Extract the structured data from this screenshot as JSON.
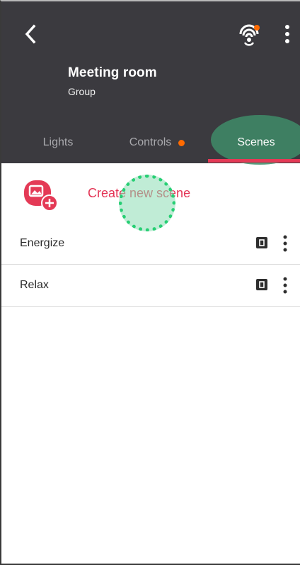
{
  "header": {
    "title": "Meeting room",
    "subtitle": "Group",
    "back_icon": "chevron-left-icon",
    "network_icon": "bridge-sync-icon",
    "more_icon": "more-vertical-icon"
  },
  "tabs": [
    {
      "label": "Lights",
      "active": false
    },
    {
      "label": "Controls",
      "active": false,
      "badge": "orange-dot"
    },
    {
      "label": "Scenes",
      "active": true
    }
  ],
  "create_scene": {
    "label": "Create new scene",
    "icon": "add-scene-icon"
  },
  "scenes": [
    {
      "label": "Energize",
      "switch_icon": "switch-icon",
      "more_icon": "more-vertical-icon"
    },
    {
      "label": "Relax",
      "switch_icon": "switch-icon",
      "more_icon": "more-vertical-icon"
    }
  ],
  "colors": {
    "header_bg": "#3b3a3f",
    "accent": "#e43a56",
    "badge": "#ff6a00",
    "tab_inactive": "#a9a9ad"
  }
}
